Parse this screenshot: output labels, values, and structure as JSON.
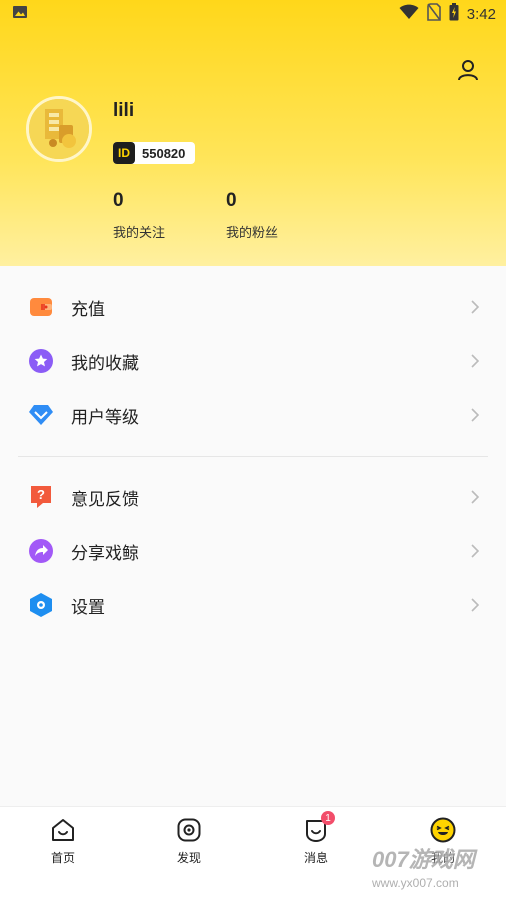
{
  "status_bar": {
    "time": "3:42"
  },
  "profile": {
    "username": "lili",
    "id_tag": "ID",
    "id_value": "550820",
    "following_count": "0",
    "following_label": "我的关注",
    "fans_count": "0",
    "fans_label": "我的粉丝"
  },
  "menu": {
    "group1": [
      {
        "label": "充值",
        "icon": "wallet-icon"
      },
      {
        "label": "我的收藏",
        "icon": "star-icon"
      },
      {
        "label": "用户等级",
        "icon": "diamond-icon"
      }
    ],
    "group2": [
      {
        "label": "意见反馈",
        "icon": "feedback-icon"
      },
      {
        "label": "分享戏鲸",
        "icon": "share-icon"
      },
      {
        "label": "设置",
        "icon": "settings-icon"
      }
    ]
  },
  "tabbar": {
    "tabs": [
      {
        "label": "首页",
        "icon": "home-icon"
      },
      {
        "label": "发现",
        "icon": "discover-icon"
      },
      {
        "label": "消息",
        "icon": "message-icon",
        "badge": "1"
      },
      {
        "label": "我的",
        "icon": "me-face-icon"
      }
    ]
  },
  "watermark": {
    "title": "007游戏网",
    "url": "www.yx007.com"
  },
  "colors": {
    "header_yellow": "#ffd71a",
    "accent_black": "#1e1e1e",
    "badge_red": "#f24d6a",
    "wallet_orange": "#ff8a3d",
    "star_purple": "#8b5cf6",
    "diamond_blue": "#2f8df5",
    "feedback_red": "#f25a3c",
    "share_purple": "#a259f7",
    "settings_blue": "#1e8ef0"
  }
}
